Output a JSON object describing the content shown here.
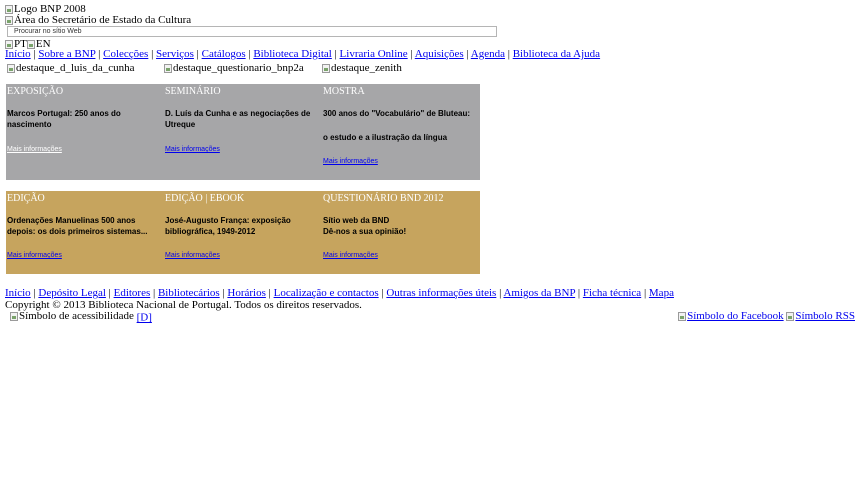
{
  "header": {
    "logo_alt": "Logo BNP 2008",
    "ministry_alt": "Área do Secretário de Estado da Cultura",
    "search_placeholder": "Procurar no sítio Web",
    "lang_pt_alt": "PT",
    "lang_en_alt": "EN"
  },
  "main_nav": [
    "Início",
    "Sobre a BNP",
    "Colecções",
    "Serviços",
    "Catálogos",
    "Biblioteca Digital",
    "Livraria Online",
    "Aquisições",
    "Agenda",
    "Biblioteca da Ajuda"
  ],
  "thumbs": [
    "destaque_d_luis_da_cunha",
    "destaque_questionario_bnp2a",
    "destaque_zenith"
  ],
  "panels_row1": [
    {
      "category": "EXPOSIÇÃO",
      "title": "Marcos Portugal: 250 anos do nascimento",
      "more": "Mais informações"
    },
    {
      "category": "SEMINÁRIO",
      "title": "D. Luís da Cunha e as negociações de Utreque",
      "more": "Mais informações"
    },
    {
      "category": "MOSTRA",
      "title": "300 anos do \"Vocabulário\" de Bluteau:",
      "subtitle": "o estudo e a ilustração da língua",
      "more": "Mais informações"
    }
  ],
  "panels_row2": [
    {
      "category": "EDIÇÃO",
      "title": "Ordenações Manuelinas 500 anos depois: os dois primeiros sistemas...",
      "more": "Mais informações"
    },
    {
      "category": "EDIÇÃO | EBOOK",
      "title": "José-Augusto França: exposição bibliográfica, 1949-2012",
      "more": "Mais informações"
    },
    {
      "category": "QUESTIONÁRIO BND 2012",
      "title": "Sítio web da BND",
      "subtitle": "Dê-nos a sua opinião!",
      "more": "Mais informações"
    }
  ],
  "footer_nav": [
    "Início",
    "Depósito Legal",
    "Editores",
    "Bibliotecários",
    "Horários",
    "Localização e contactos",
    "Outras informações úteis",
    "Amigos da BNP",
    "Ficha técnica",
    "Mapa"
  ],
  "copyright": "Copyright © 2013 Biblioteca Nacional de Portugal. Todos os direitos reservados.",
  "accessibility": {
    "alt": "Símbolo de acessibilidade",
    "link": "[D]"
  },
  "social": {
    "facebook_alt": "Símbolo do Facebook",
    "rss_alt": "Símbolo RSS"
  },
  "colors": {
    "grey_panel": "#a6a6a8",
    "gold_panel": "#c6a45e",
    "link": "#0000ee"
  }
}
